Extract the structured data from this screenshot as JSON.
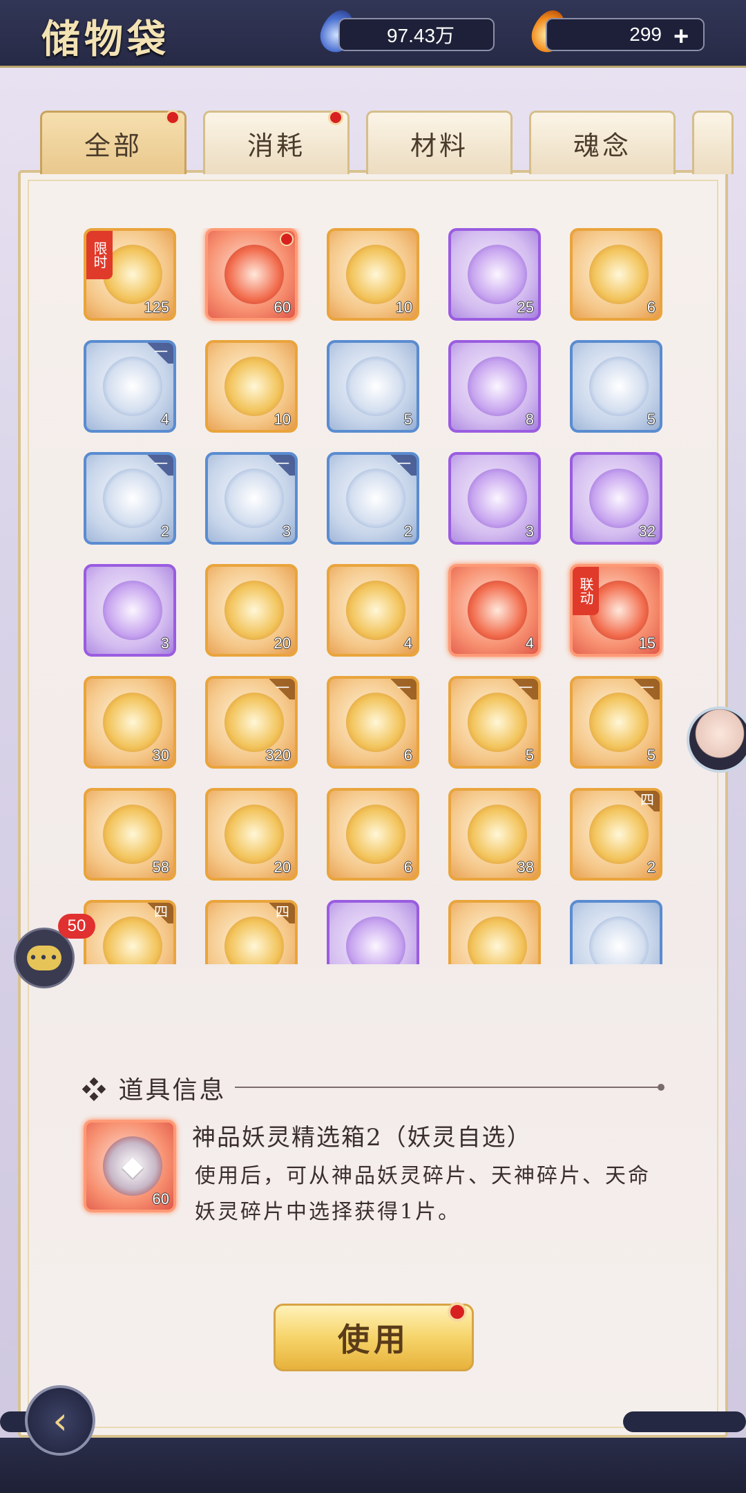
{
  "header": {
    "title": "储物袋",
    "currency1": {
      "value": "97.43万",
      "icon": "spirit-jade-icon"
    },
    "currency2": {
      "value": "299",
      "icon": "gold-flame-icon",
      "add_label": "+"
    }
  },
  "tabs": [
    {
      "label": "全部",
      "active": true,
      "dot": true
    },
    {
      "label": "消耗",
      "active": false,
      "dot": true
    },
    {
      "label": "材料",
      "active": false,
      "dot": false
    },
    {
      "label": "魂念",
      "active": false,
      "dot": false
    }
  ],
  "items": [
    {
      "q": "gold",
      "count": "125",
      "tag": "限时"
    },
    {
      "q": "red",
      "count": "60",
      "dot": true
    },
    {
      "q": "gold",
      "count": "10"
    },
    {
      "q": "purple",
      "count": "25"
    },
    {
      "q": "gold",
      "count": "6"
    },
    {
      "q": "blue",
      "count": "4",
      "corner": "一"
    },
    {
      "q": "gold",
      "count": "10"
    },
    {
      "q": "blue",
      "count": "5"
    },
    {
      "q": "purple",
      "count": "8"
    },
    {
      "q": "blue",
      "count": "5"
    },
    {
      "q": "blue",
      "count": "2",
      "corner": "一"
    },
    {
      "q": "blue",
      "count": "3",
      "corner": "一"
    },
    {
      "q": "blue",
      "count": "2",
      "corner": "一"
    },
    {
      "q": "purple",
      "count": "3"
    },
    {
      "q": "purple",
      "count": "32"
    },
    {
      "q": "purple",
      "count": "3"
    },
    {
      "q": "gold",
      "count": "20"
    },
    {
      "q": "gold",
      "count": "4"
    },
    {
      "q": "red",
      "count": "4"
    },
    {
      "q": "red",
      "count": "15",
      "tag": "联动"
    },
    {
      "q": "gold",
      "count": "30"
    },
    {
      "q": "gold",
      "count": "320",
      "corner": "一"
    },
    {
      "q": "gold",
      "count": "6",
      "corner": "一"
    },
    {
      "q": "gold",
      "count": "5",
      "corner": "一"
    },
    {
      "q": "gold",
      "count": "5",
      "corner": "一"
    },
    {
      "q": "gold",
      "count": "58"
    },
    {
      "q": "gold",
      "count": "20"
    },
    {
      "q": "gold",
      "count": "6"
    },
    {
      "q": "gold",
      "count": "38"
    },
    {
      "q": "gold",
      "count": "2",
      "corner": "四"
    },
    {
      "q": "gold",
      "count": "",
      "corner": "四"
    },
    {
      "q": "gold",
      "count": "",
      "corner": "四"
    },
    {
      "q": "purple",
      "count": ""
    },
    {
      "q": "gold",
      "count": ""
    },
    {
      "q": "blue",
      "count": ""
    }
  ],
  "chat": {
    "badge": "50",
    "icon": "chat-bubble-icon"
  },
  "info": {
    "header": "❖ 道具信息",
    "item_count": "60",
    "name": "神品妖灵精选箱2（妖灵自选）",
    "description": "使用后，可从神品妖灵碎片、天神碎片、天命妖灵碎片中选择获得1片。"
  },
  "use_button": "使用",
  "back_icon": "back-arrow-icon"
}
